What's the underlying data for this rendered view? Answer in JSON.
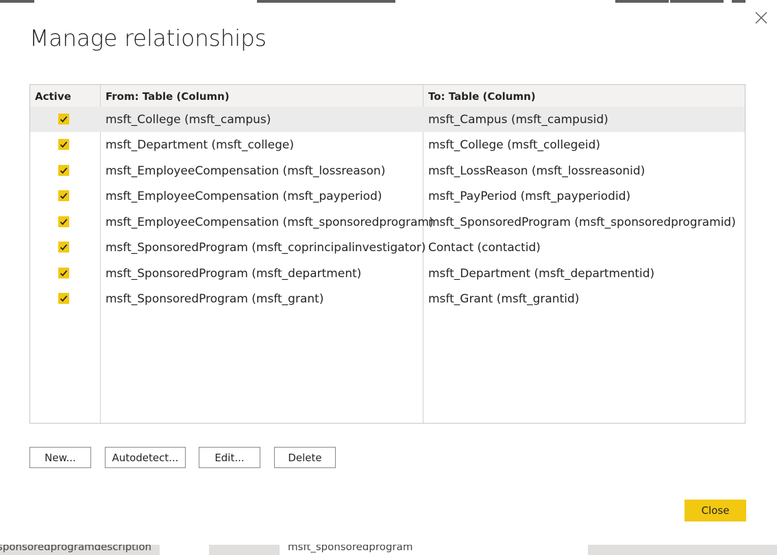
{
  "dialog": {
    "title": "Manage relationships",
    "close_icon": "close-icon"
  },
  "table": {
    "headers": {
      "active": "Active",
      "from": "From: Table (Column)",
      "to": "To: Table (Column)"
    },
    "rows": [
      {
        "active": true,
        "from": "msft_College (msft_campus)",
        "to": "msft_Campus (msft_campusid)",
        "selected": true
      },
      {
        "active": true,
        "from": "msft_Department (msft_college)",
        "to": "msft_College (msft_collegeid)"
      },
      {
        "active": true,
        "from": "msft_EmployeeCompensation (msft_lossreason)",
        "to": "msft_LossReason (msft_lossreasonid)"
      },
      {
        "active": true,
        "from": "msft_EmployeeCompensation (msft_payperiod)",
        "to": "msft_PayPeriod (msft_payperiodid)"
      },
      {
        "active": true,
        "from": "msft_EmployeeCompensation (msft_sponsoredprogram)",
        "to": "msft_SponsoredProgram (msft_sponsoredprogramid)"
      },
      {
        "active": true,
        "from": "msft_SponsoredProgram (msft_coprincipalinvestigator)",
        "to": "Contact (contactid)"
      },
      {
        "active": true,
        "from": "msft_SponsoredProgram (msft_department)",
        "to": "msft_Department (msft_departmentid)"
      },
      {
        "active": true,
        "from": "msft_SponsoredProgram (msft_grant)",
        "to": "msft_Grant (msft_grantid)"
      }
    ]
  },
  "buttons": {
    "new": "New...",
    "autodetect": "Autodetect...",
    "edit": "Edit...",
    "delete": "Delete",
    "close": "Close"
  },
  "background": {
    "left_text": "sponsoredprogramdescription",
    "right_text": "msft_sponsoredprogram"
  },
  "colors": {
    "accent": "#f2c811",
    "selected_row": "#ebebeb",
    "header_bg": "#f3f2f1"
  }
}
